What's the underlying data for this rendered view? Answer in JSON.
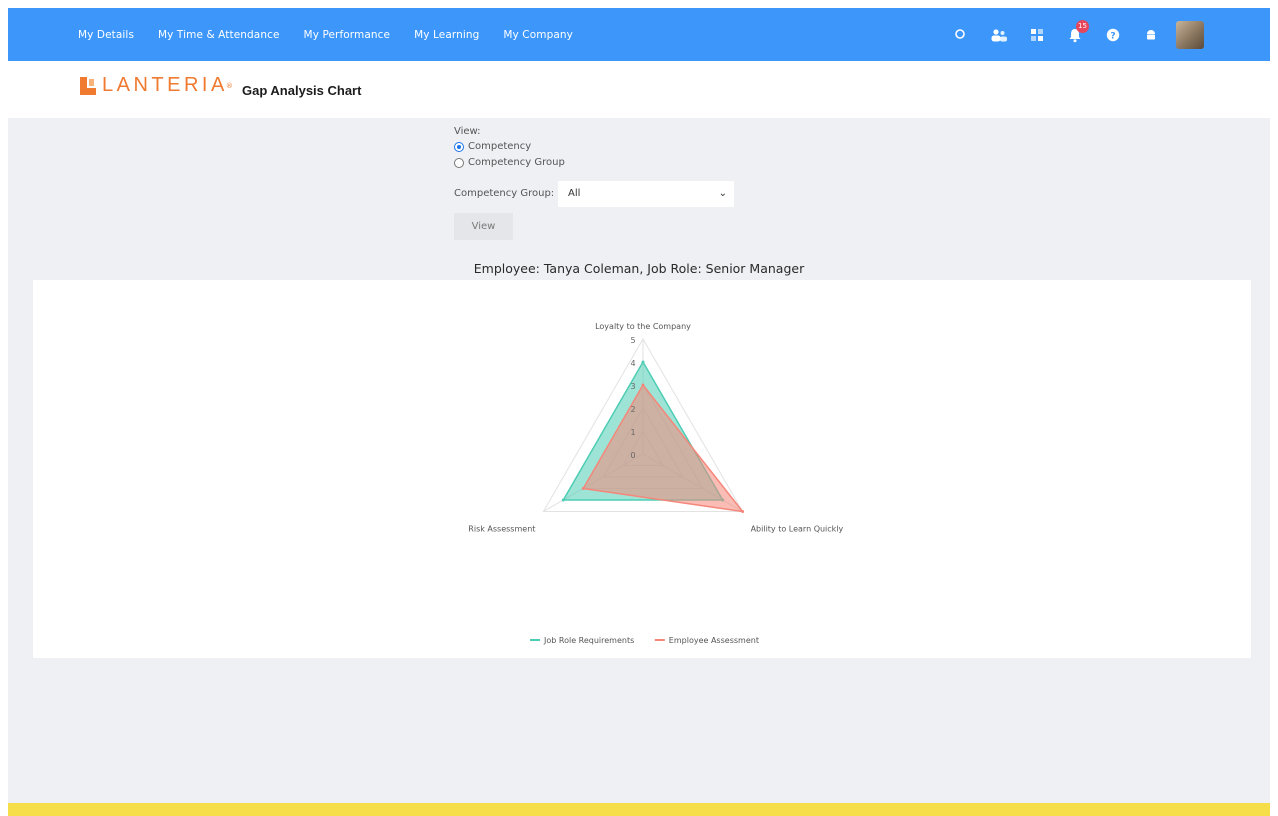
{
  "nav": {
    "items": [
      "My Details",
      "My Time & Attendance",
      "My Performance",
      "My Learning",
      "My Company"
    ],
    "notification_count": "15",
    "icons": [
      "search-icon",
      "people-icon",
      "apps-grid-icon",
      "bell-icon",
      "help-icon",
      "android-icon"
    ]
  },
  "header": {
    "logo_text": "LANTERIA",
    "logo_reg": "®",
    "title": "Gap Analysis Chart"
  },
  "form": {
    "view_label": "View:",
    "options": [
      "Competency",
      "Competency Group"
    ],
    "selected_option": "Competency",
    "group_label": "Competency Group:",
    "group_value": "All",
    "view_button": "View"
  },
  "employee_title": "Employee: Tanya Coleman, Job Role: Senior Manager",
  "colors": {
    "nav": "#3d97fb",
    "brand": "#ef7a30",
    "job_role": "#4ecdb4",
    "employee": "#f4877a",
    "footer": "#f6dd4a"
  },
  "chart_data": {
    "type": "radar",
    "categories": [
      "Loyalty to the Company",
      "Ability to Learn Quickly",
      "Risk Assessment"
    ],
    "ticks": [
      "0",
      "1",
      "2",
      "3",
      "4",
      "5"
    ],
    "rmax": 5,
    "series": [
      {
        "name": "Job Role Requirements",
        "values": [
          4,
          4,
          4
        ]
      },
      {
        "name": "Employee Assessment",
        "values": [
          3,
          5,
          3
        ]
      }
    ],
    "legend_position": "bottom"
  }
}
